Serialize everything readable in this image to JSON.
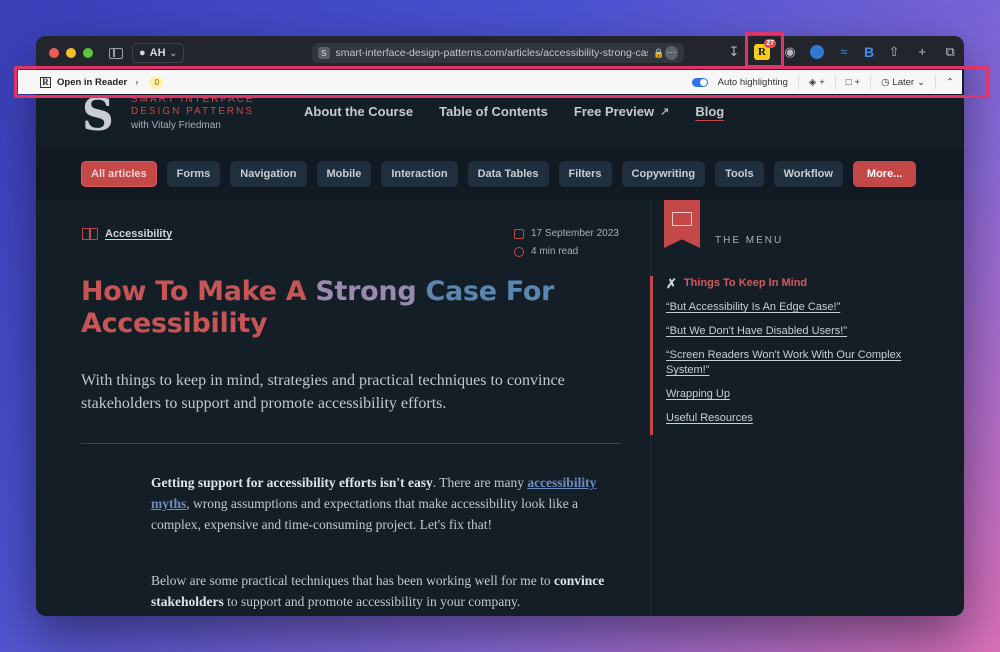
{
  "browser": {
    "profile": "AH",
    "url": "smart-interface-design-patterns.com/articles/accessibility-strong-case/",
    "ext_badge": "27"
  },
  "reader_bar": {
    "open_label": "Open in Reader",
    "count": "0",
    "auto_highlighting": "Auto highlighting",
    "later_label": "Later"
  },
  "site": {
    "logo_letter": "S",
    "logo_line1": "SMART INTERFACE",
    "logo_line2": "DESIGN PATTERNS",
    "logo_author": "with Vitaly Friedman",
    "nav": [
      "About the Course",
      "Table of Contents",
      "Free Preview",
      "Blog"
    ]
  },
  "categories": [
    "All articles",
    "Forms",
    "Navigation",
    "Mobile",
    "Interaction",
    "Data Tables",
    "Filters",
    "Copywriting",
    "Tools",
    "Workflow",
    "More..."
  ],
  "article": {
    "category": "Accessibility",
    "date": "17 September 2023",
    "read_time": "4 min read",
    "title_w1": "How To Make A ",
    "title_w2": "Strong ",
    "title_w3": "Case For",
    "title_w4": "Accessibility",
    "subtitle": "With things to keep in mind, strategies and practical techniques to convince stakeholders to support and promote accessibility efforts.",
    "p1_bold": "Getting support for accessibility efforts isn't easy",
    "p1_a": ". There are many ",
    "p1_link": "accessibility myths",
    "p1_b": ", wrong assumptions and expectations that make accessibility look like a complex, expensive and time-consuming project. Let's fix that!",
    "p2_a": "Below are some practical techniques that has been working well for me to ",
    "p2_bold": "convince stakeholders",
    "p2_b": " to support and promote accessibility in your company."
  },
  "sidebar": {
    "menu_title": "THE MENU",
    "items": [
      "Things To Keep In Mind",
      "“But Accessibility Is An Edge Case!”",
      "“But We Don't Have Disabled Users!”",
      "“Screen Readers Won't Work With Our Complex System!”",
      "Wrapping Up",
      "Useful Resources"
    ]
  }
}
